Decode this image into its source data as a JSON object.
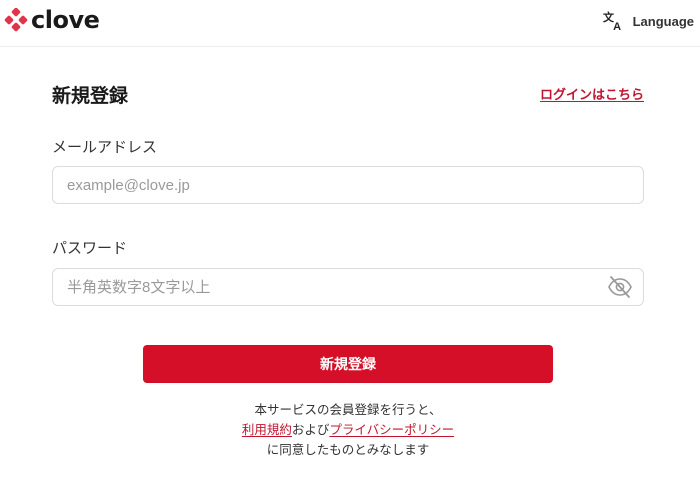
{
  "header": {
    "logo_text": "clove",
    "language_label": "Language",
    "logo_color": "#e0344a"
  },
  "form": {
    "title": "新規登録",
    "login_link": "ログインはこちら",
    "email": {
      "label": "メールアドレス",
      "placeholder": "example@clove.jp",
      "value": ""
    },
    "password": {
      "label": "パスワード",
      "placeholder": "半角英数字8文字以上",
      "value": ""
    },
    "submit_label": "新規登録",
    "accent_color": "#d40f27"
  },
  "terms": {
    "line1": "本サービスの会員登録を行うと、",
    "terms_link": "利用規約",
    "and_text": "および",
    "privacy_link": "プライバシーポリシー",
    "line3": "に同意したものとみなします"
  }
}
